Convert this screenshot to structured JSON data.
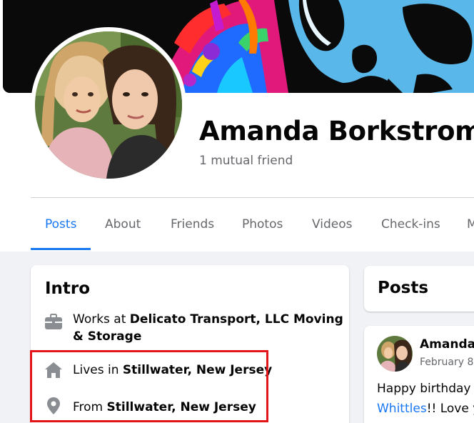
{
  "profile": {
    "name": "Amanda Borkstrom",
    "mutual_friends": "1 mutual friend"
  },
  "tabs": [
    {
      "label": "Posts",
      "active": true
    },
    {
      "label": "About"
    },
    {
      "label": "Friends"
    },
    {
      "label": "Photos"
    },
    {
      "label": "Videos"
    },
    {
      "label": "Check-ins"
    },
    {
      "label": "M"
    }
  ],
  "intro": {
    "title": "Intro",
    "work": {
      "prefix": "Works at ",
      "value": "Delicato Transport, LLC Moving & Storage",
      "icon": "briefcase-icon"
    },
    "lives": {
      "prefix": "Lives in ",
      "value": "Stillwater, New Jersey",
      "icon": "home-icon"
    },
    "from": {
      "prefix": "From ",
      "value": "Stillwater, New Jersey",
      "icon": "location-pin-icon"
    }
  },
  "posts_section": {
    "title": "Posts"
  },
  "post": {
    "author": "Amanda",
    "date": "February 8",
    "text_prefix": "Happy birthday t",
    "link": "Whittles",
    "text_suffix": "!! Love y"
  },
  "colors": {
    "accent": "#1877f2",
    "highlight_box": "#e4141b",
    "muted_text": "#65676b",
    "page_bg": "#f0f2f5"
  }
}
